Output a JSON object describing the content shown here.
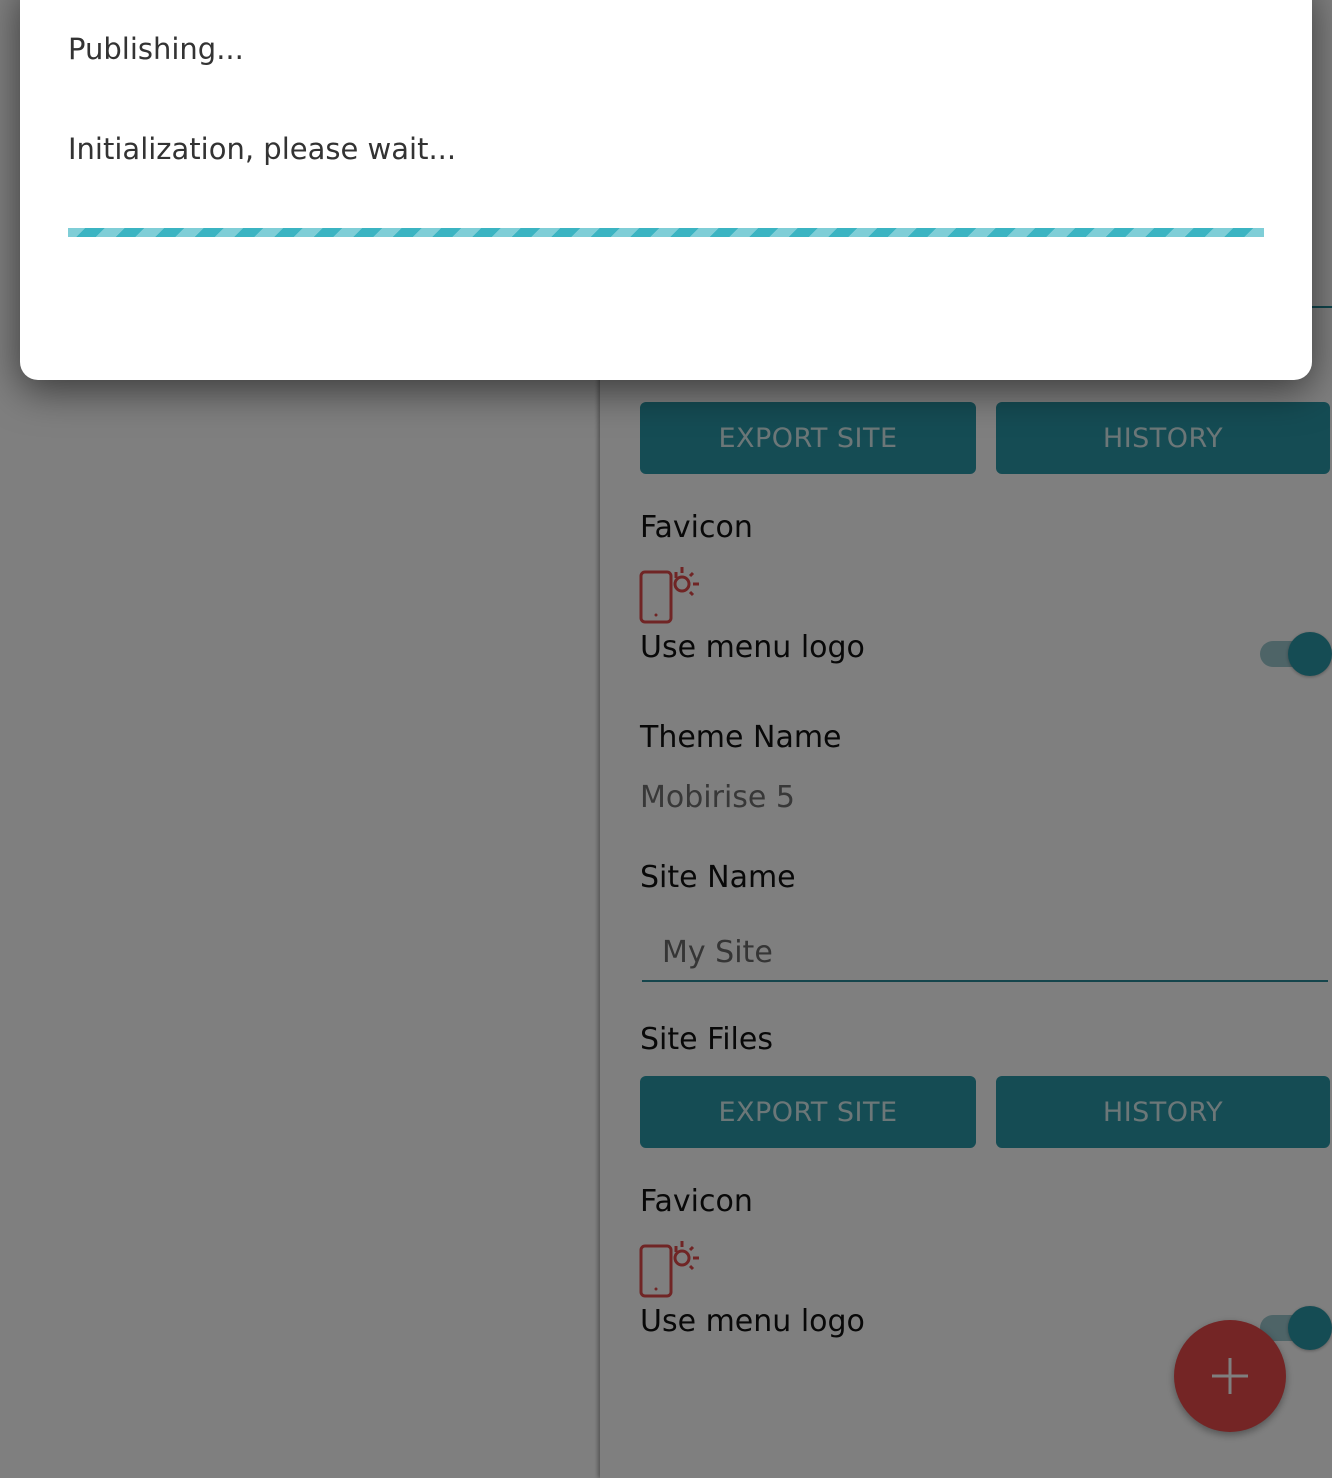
{
  "modal": {
    "title": "Publishing...",
    "status": "Initialization, please wait...",
    "progress_fraction": 1.0
  },
  "panel": {
    "section1": {
      "export_button": "EXPORT SITE",
      "history_button": "HISTORY",
      "favicon_label": "Favicon",
      "use_menu_logo_label": "Use menu logo",
      "use_menu_logo_enabled": true
    },
    "theme_name_label": "Theme Name",
    "theme_name_value": "Mobirise 5",
    "site_name_label": "Site Name",
    "site_name_value": "My Site",
    "site_files_label": "Site Files",
    "section2": {
      "export_button": "EXPORT SITE",
      "history_button": "HISTORY",
      "favicon_label": "Favicon",
      "use_menu_logo_label": "Use menu logo",
      "use_menu_logo_enabled": true
    }
  },
  "icons": {
    "favicon": "phone-favicon-icon",
    "fab": "plus-icon"
  },
  "colors": {
    "accent": "#2a99a8",
    "fab": "#e84a4a",
    "progress": "#3bb4c2",
    "overlay": "rgba(0,0,0,0.5)"
  }
}
